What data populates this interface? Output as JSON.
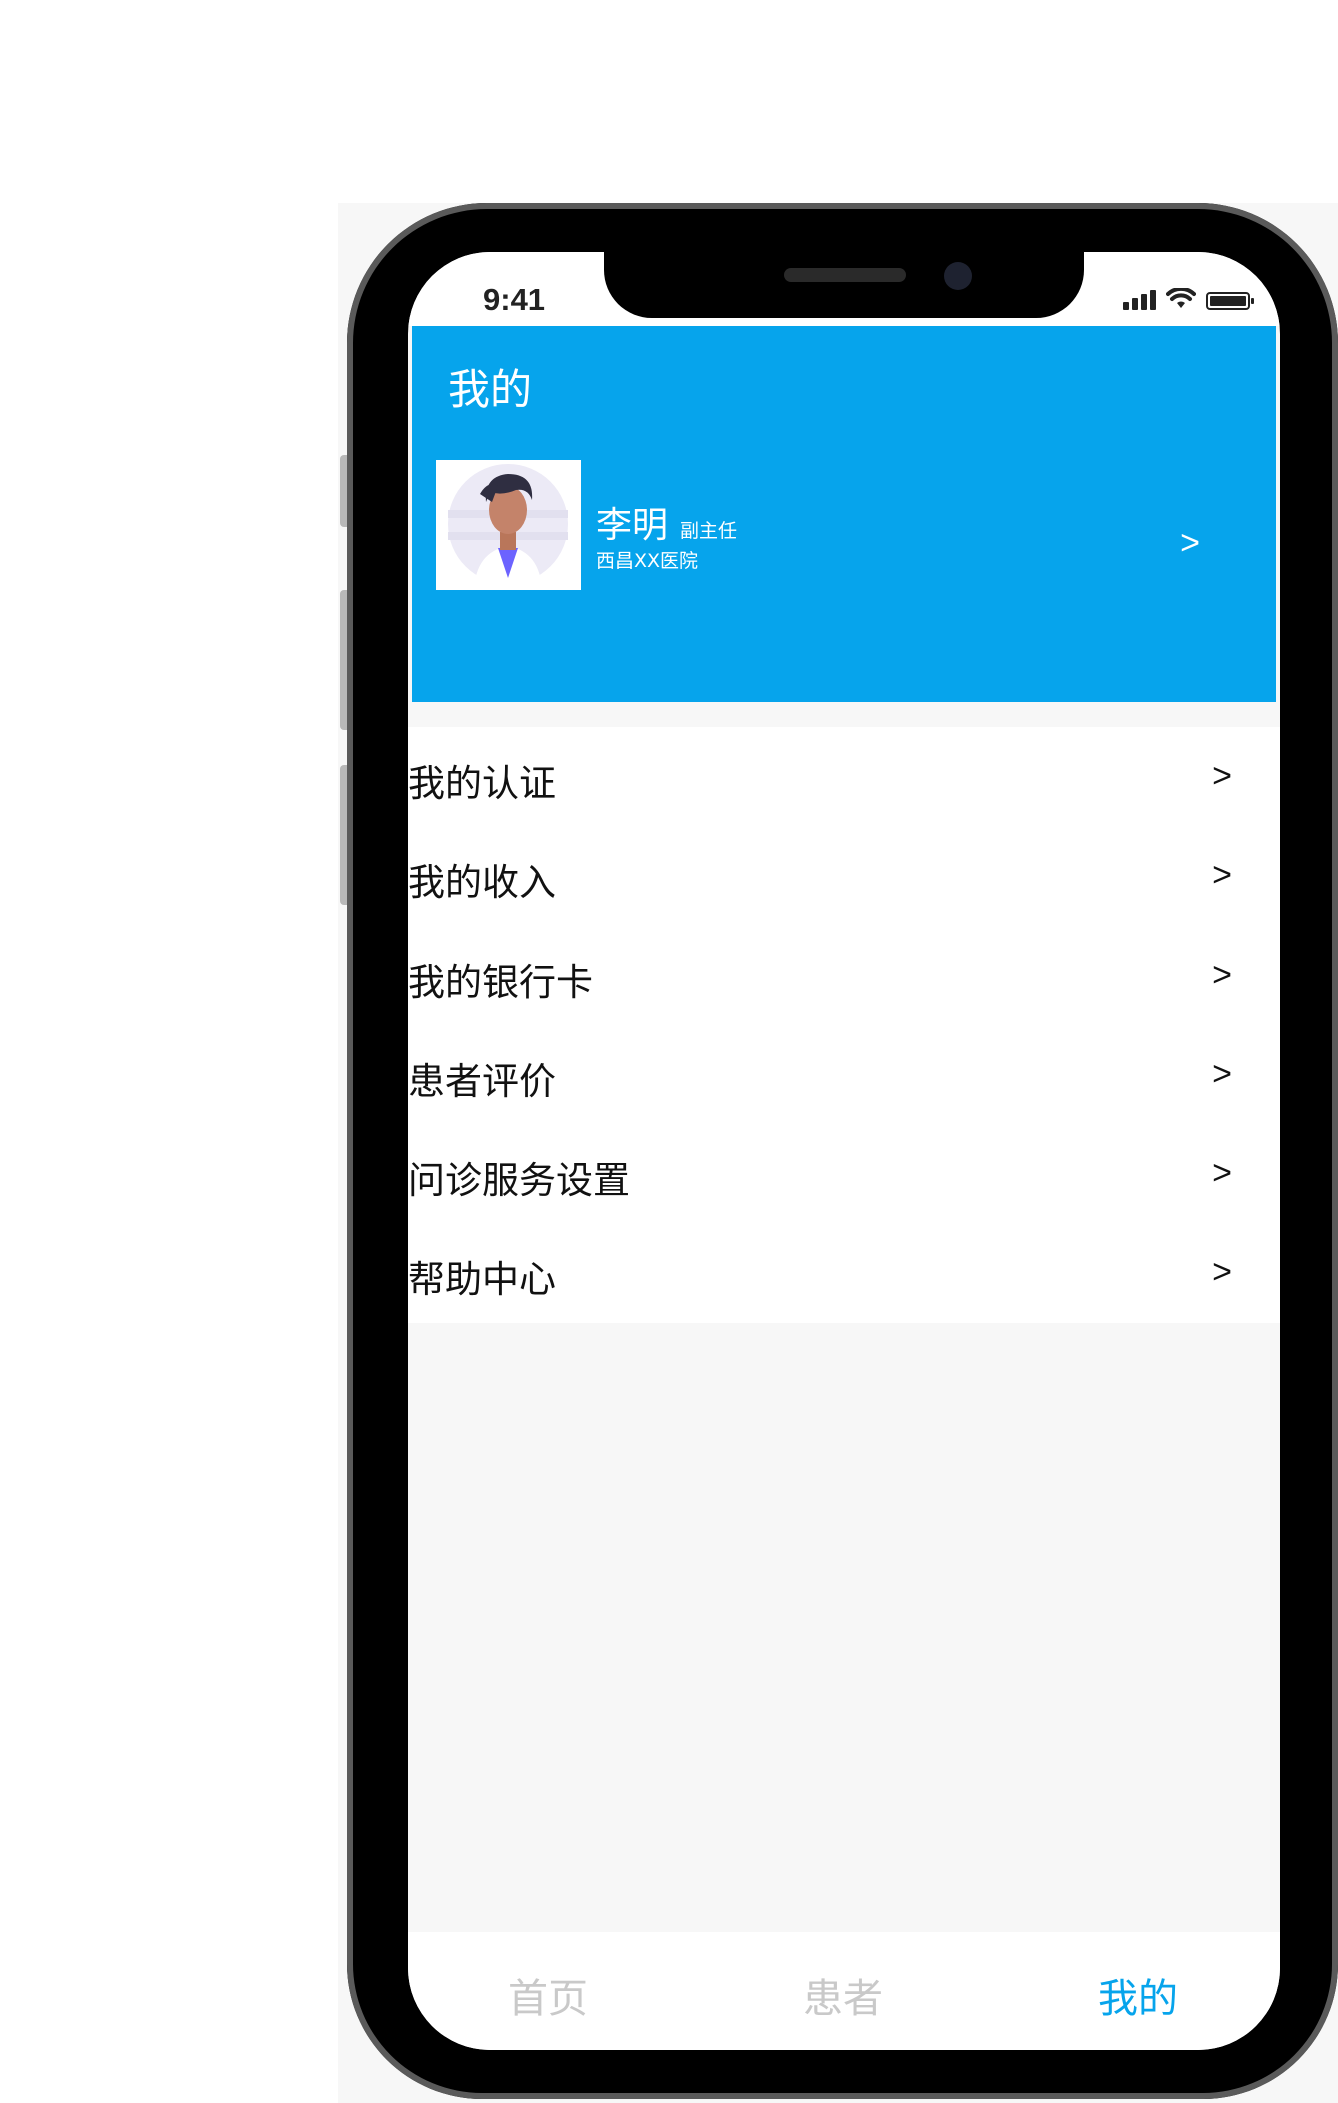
{
  "status_bar": {
    "time": "9:41"
  },
  "header": {
    "title": "我的",
    "doctor_name": "李明",
    "doctor_title": "副主任",
    "hospital": "西昌XX医院",
    "arrow": ">"
  },
  "menu": {
    "items": [
      {
        "label": "我的认证",
        "arrow": ">"
      },
      {
        "label": "我的收入",
        "arrow": ">"
      },
      {
        "label": "我的银行卡",
        "arrow": ">"
      },
      {
        "label": "患者评价",
        "arrow": ">"
      },
      {
        "label": "问诊服务设置",
        "arrow": ">"
      },
      {
        "label": "帮助中心",
        "arrow": ">"
      }
    ]
  },
  "tabbar": {
    "tabs": [
      {
        "label": "首页",
        "active": false
      },
      {
        "label": "患者",
        "active": false
      },
      {
        "label": "我的",
        "active": true
      }
    ]
  },
  "colors": {
    "accent": "#06a4ec",
    "inactive_tab": "#c9c9c9"
  }
}
